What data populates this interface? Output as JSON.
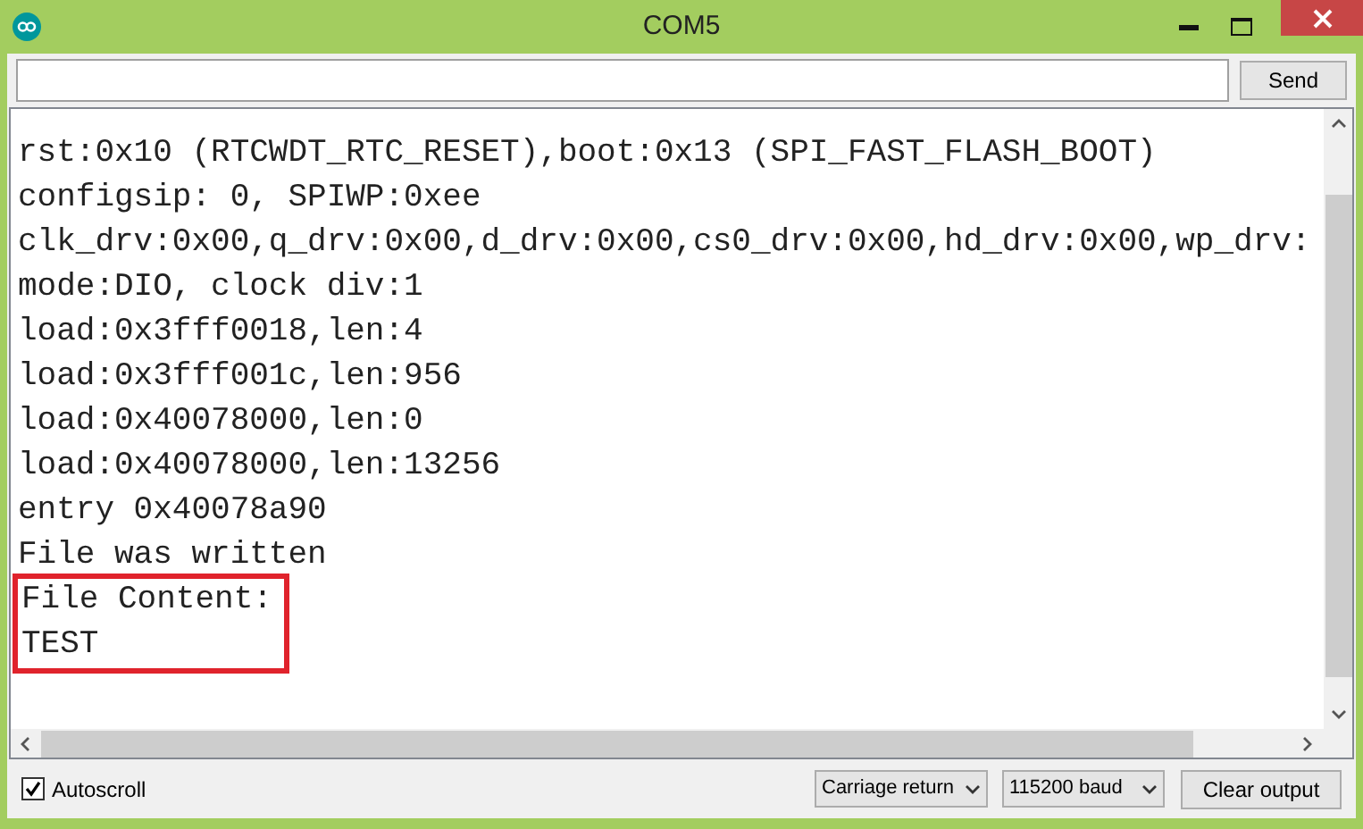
{
  "window": {
    "title": "COM5"
  },
  "send_button": "Send",
  "output": {
    "lines": [
      {
        "text": "rst:0x10 (RTCWDT_RTC_RESET),boot:0x13 (SPI_FAST_FLASH_BOOT)",
        "highlighted": false
      },
      {
        "text": "configsip: 0, SPIWP:0xee",
        "highlighted": false
      },
      {
        "text": "clk_drv:0x00,q_drv:0x00,d_drv:0x00,cs0_drv:0x00,hd_drv:0x00,wp_drv:",
        "highlighted": false
      },
      {
        "text": "mode:DIO, clock div:1",
        "highlighted": false
      },
      {
        "text": "load:0x3fff0018,len:4",
        "highlighted": false
      },
      {
        "text": "load:0x3fff001c,len:956",
        "highlighted": false
      },
      {
        "text": "load:0x40078000,len:0",
        "highlighted": false
      },
      {
        "text": "load:0x40078000,len:13256",
        "highlighted": false
      },
      {
        "text": "entry 0x40078a90",
        "highlighted": false
      },
      {
        "text": "File was written",
        "highlighted": false
      },
      {
        "text": "File Content:",
        "highlighted": true
      },
      {
        "text": "TEST",
        "highlighted": true
      }
    ]
  },
  "autoscroll": {
    "label": "Autoscroll",
    "checked": true
  },
  "line_ending": "Carriage return",
  "baud": "115200 baud",
  "clear_button": "Clear output"
}
